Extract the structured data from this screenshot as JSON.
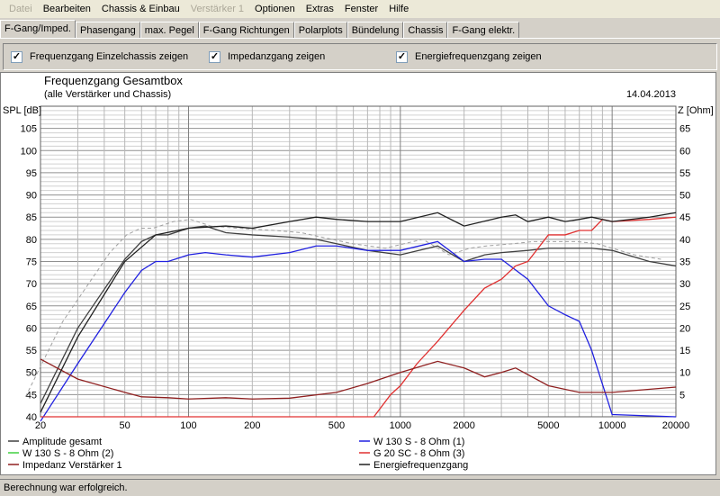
{
  "menu": [
    "Datei",
    "Bearbeiten",
    "Chassis & Einbau",
    "Verstärker 1",
    "Optionen",
    "Extras",
    "Fenster",
    "Hilfe"
  ],
  "tabs": [
    "F-Gang/Imped.",
    "Phasengang",
    "max. Pegel",
    "F-Gang Richtungen",
    "Polarplots",
    "Bündelung",
    "Chassis",
    "F-Gang elektr."
  ],
  "checkboxes": [
    {
      "label": "Frequenzgang Einzelchassis zeigen",
      "checked": true
    },
    {
      "label": "Impedanzgang zeigen",
      "checked": true
    },
    {
      "label": "Energiefrequenzgang zeigen",
      "checked": true
    }
  ],
  "status": "Berechnung war erfolgreich.",
  "chart_data": {
    "type": "line",
    "title": "Frequenzgang Gesamtbox",
    "subtitle": "(alle Verstärker und Chassis)",
    "date": "14.04.2013",
    "ylabel": "SPL [dB]",
    "y2label": "Z [Ohm]",
    "xscale": "log",
    "xlim": [
      20,
      20000
    ],
    "ylim": [
      40,
      110
    ],
    "y2lim": [
      0,
      70
    ],
    "xticks": [
      "20",
      "50",
      "100",
      "200",
      "500",
      "1000",
      "2000",
      "5000",
      "10000",
      "20000"
    ],
    "yticks": [
      "40",
      "45",
      "50",
      "55",
      "60",
      "65",
      "70",
      "75",
      "80",
      "85",
      "90",
      "95",
      "100",
      "105"
    ],
    "y2ticks": [
      "5",
      "10",
      "15",
      "20",
      "25",
      "30",
      "35",
      "40",
      "45",
      "50",
      "55",
      "60",
      "65"
    ],
    "grid": true,
    "legend_placement": "bottom",
    "series": [
      {
        "name": "Amplitude gesamt",
        "color": "#404040",
        "axis": "left",
        "x": [
          20,
          30,
          50,
          60,
          70,
          80,
          100,
          120,
          150,
          200,
          300,
          400,
          500,
          700,
          1000,
          1500,
          2000,
          2500,
          3000,
          4000,
          5000,
          6000,
          8000,
          10000,
          15000,
          20000
        ],
        "y": [
          43,
          60,
          75.5,
          79.5,
          81,
          81,
          82.5,
          83,
          81.5,
          81,
          80.5,
          80,
          79,
          77.5,
          76.5,
          78.5,
          75,
          76.5,
          77,
          77.5,
          78,
          78,
          78,
          77.5,
          75,
          74
        ]
      },
      {
        "name": "W 130 S - 8 Ohm (1)",
        "color": "#2020e0",
        "axis": "left",
        "x": [
          20,
          30,
          40,
          50,
          60,
          70,
          80,
          100,
          120,
          150,
          200,
          300,
          400,
          500,
          700,
          1000,
          1500,
          2000,
          2500,
          3000,
          4000,
          5000,
          6000,
          7000,
          8000,
          10000,
          20000
        ],
        "y": [
          39,
          52,
          61,
          68,
          73,
          75,
          75,
          76.5,
          77,
          76.5,
          76,
          77,
          78.5,
          78.5,
          77.5,
          77.5,
          79.5,
          75,
          75.5,
          75.5,
          71,
          65,
          63,
          61.5,
          55,
          40.5,
          40
        ]
      },
      {
        "name": "W 130 S - 8 Ohm (2)",
        "color": "#40d040",
        "axis": "left",
        "x": [],
        "y": []
      },
      {
        "name": "G 20 SC - 8 Ohm (3)",
        "color": "#e03030",
        "axis": "left",
        "x": [
          20,
          750,
          900,
          1000,
          1200,
          1500,
          2000,
          2500,
          3000,
          3500,
          4000,
          5000,
          6000,
          7000,
          8000,
          9000,
          10000,
          15000,
          20000
        ],
        "y": [
          40,
          40,
          45,
          47,
          52,
          57,
          64,
          69,
          71,
          74,
          75,
          81,
          81,
          82,
          82,
          84.5,
          84,
          84.5,
          85
        ]
      },
      {
        "name": "Impedanz Verstärker 1",
        "color": "#902020",
        "axis": "right",
        "x": [
          20,
          30,
          50,
          60,
          80,
          100,
          150,
          200,
          300,
          500,
          700,
          1000,
          1500,
          2000,
          2500,
          3000,
          3500,
          5000,
          7000,
          10000,
          20000
        ],
        "y": [
          13,
          8.5,
          5.5,
          4.5,
          4.3,
          4,
          4.3,
          4,
          4.2,
          5.5,
          7.5,
          10,
          12.5,
          11,
          9,
          10,
          11,
          7,
          5.5,
          5.5,
          6.7
        ]
      },
      {
        "name": "Energiefrequenzgang",
        "color": "#202020",
        "axis": "left",
        "x": [
          20,
          30,
          50,
          70,
          100,
          150,
          200,
          300,
          400,
          500,
          700,
          1000,
          1500,
          2000,
          3000,
          3500,
          4000,
          5000,
          6000,
          7000,
          8000,
          10000,
          15000,
          20000
        ],
        "y": [
          41,
          58,
          75,
          81,
          82.5,
          83,
          82.5,
          84,
          85,
          84.5,
          84,
          84,
          86,
          83,
          85,
          85.5,
          84,
          85,
          84,
          84.5,
          85,
          84,
          85,
          86
        ]
      }
    ]
  }
}
